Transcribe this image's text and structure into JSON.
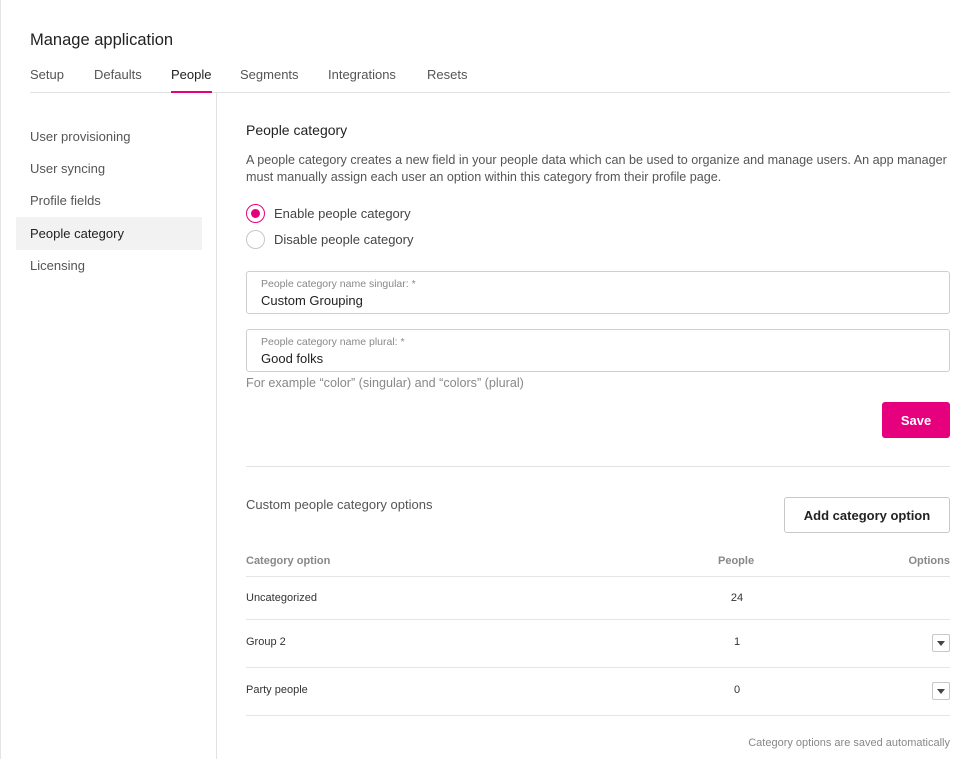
{
  "app": {
    "title": "Manage application"
  },
  "tabs": [
    {
      "label": "Setup"
    },
    {
      "label": "Defaults"
    },
    {
      "label": "People"
    },
    {
      "label": "Segments"
    },
    {
      "label": "Integrations"
    },
    {
      "label": "Resets"
    }
  ],
  "active_tab": "People",
  "sidebar": {
    "items": [
      {
        "label": "User provisioning"
      },
      {
        "label": "User syncing"
      },
      {
        "label": "Profile fields"
      },
      {
        "label": "People category"
      },
      {
        "label": "Licensing"
      }
    ],
    "active": "People category"
  },
  "main": {
    "title": "People category",
    "description": "A people category creates a new field in your people data which can be used to organize and manage users. An app manager must manually assign each user an option within this category from their profile page.",
    "radios": [
      {
        "label": "Enable people category",
        "checked": true
      },
      {
        "label": "Disable people category",
        "checked": false
      }
    ],
    "singular_field": {
      "label": "People category name singular: *",
      "value": "Custom Grouping"
    },
    "plural_field": {
      "label": "People category name plural: *",
      "value": "Good folks"
    },
    "hint": "For example “color” (singular) and “colors” (plural)",
    "save_label": "Save",
    "options_title": "Custom people category options",
    "add_button_label": "Add category option",
    "table": {
      "headers": {
        "option": "Category option",
        "people": "People",
        "options": "Options"
      },
      "rows": [
        {
          "option": "Uncategorized",
          "people": "24",
          "has_menu": false
        },
        {
          "option": "Group 2",
          "people": "1",
          "has_menu": true
        },
        {
          "option": "Party people",
          "people": "0",
          "has_menu": true
        }
      ]
    },
    "footnote": "Category options are saved automatically"
  },
  "colors": {
    "accent": "#e6007e",
    "active_bg": "#f2f2f2",
    "border": "#e2e2e2"
  },
  "icons": {
    "row_menu": "chevron-down-icon"
  }
}
